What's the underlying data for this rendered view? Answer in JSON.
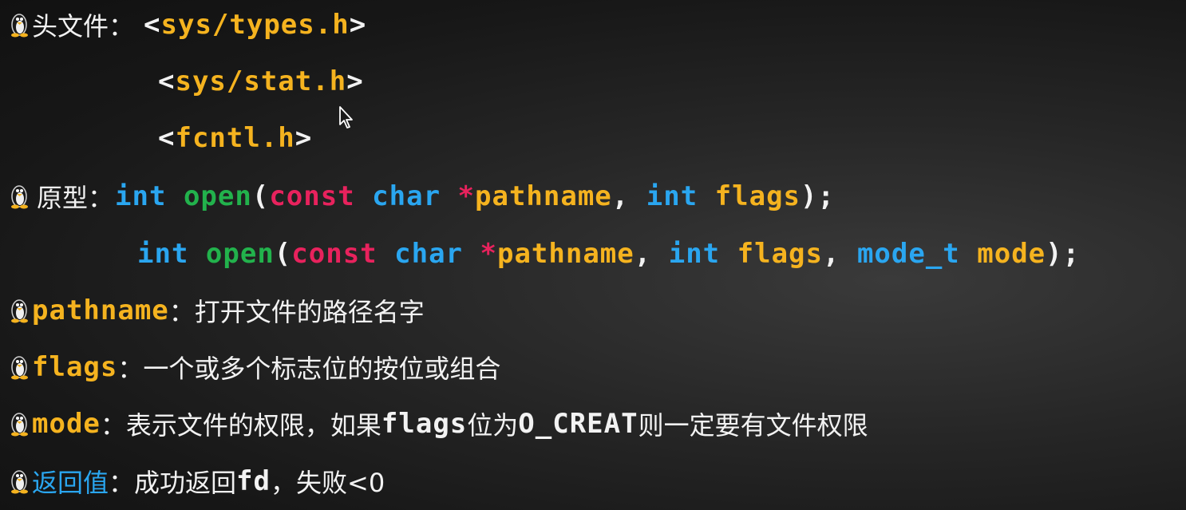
{
  "header_section": {
    "label": "头文件",
    "sep": "：",
    "headers": [
      "<sys/types.h>",
      "<sys/stat.h>",
      "<fcntl.h>"
    ]
  },
  "prototype_section": {
    "label": "原型",
    "sep": "：",
    "proto1": {
      "ret": "int",
      "func": "open",
      "lparen": "(",
      "const": "const",
      "char": "char",
      "star_param": "*pathname",
      "comma": ",",
      "int2": "int",
      "flags": "flags",
      "end": ");"
    },
    "proto2": {
      "ret": "int",
      "func": "open",
      "lparen": "(",
      "const": "const",
      "char": "char",
      "star_param": "*pathname",
      "comma1": ",",
      "int2": "int",
      "flags": "flags",
      "comma2": ",",
      "mode_t": "mode_t",
      "mode": "mode",
      "end": ");"
    }
  },
  "params": {
    "pathname": {
      "label": "pathname",
      "sep": "：",
      "desc": "打开文件的路径名字"
    },
    "flags": {
      "label": "flags",
      "sep": "：",
      "desc": "一个或多个标志位的按位或组合"
    },
    "mode": {
      "label": "mode",
      "sep": "：",
      "desc_a": "表示文件的权限，如果",
      "code_flags": "flags",
      "desc_b": "位为",
      "code_creat": "O_CREAT",
      "desc_c": "则一定要有文件权限"
    }
  },
  "return_section": {
    "label": "返回值",
    "sep": "：",
    "desc_a": "成功返回",
    "code_fd": "fd",
    "desc_b": "，失败<0"
  },
  "colors": {
    "yellow": "#f5b31f",
    "blue": "#2aa6f0",
    "green": "#22b24c",
    "red": "#e8225d",
    "text": "#f2f2f2"
  },
  "icons": {
    "bullet": "tux-penguin-icon",
    "cursor": "mouse-pointer-icon"
  }
}
